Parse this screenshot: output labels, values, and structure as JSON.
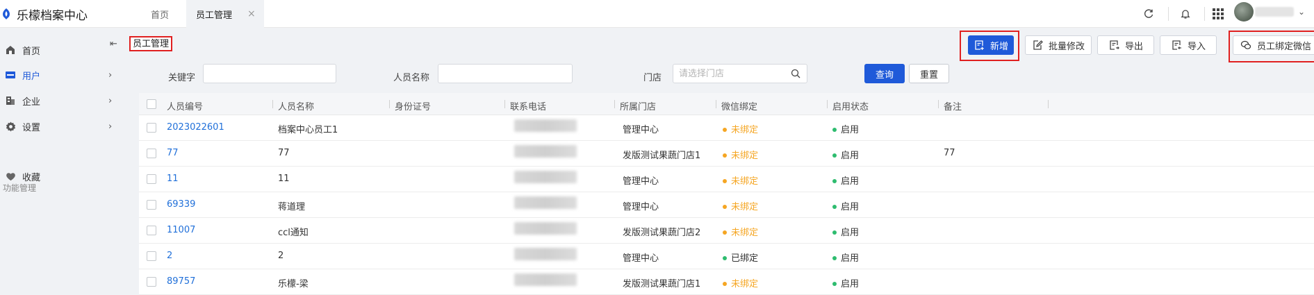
{
  "app": {
    "title": "乐檬档案中心"
  },
  "tabs": [
    {
      "label": "首页"
    },
    {
      "label": "员工管理",
      "close": "×"
    }
  ],
  "sidebar": {
    "collapse_icon": "⇤",
    "items": [
      {
        "label": "首页",
        "icon": "home-icon"
      },
      {
        "label": "用户",
        "icon": "user-card-icon",
        "chevron": "›"
      },
      {
        "label": "企业",
        "icon": "building-icon",
        "chevron": "›"
      },
      {
        "label": "设置",
        "icon": "gear-icon",
        "chevron": "›"
      }
    ],
    "group_label": "功能管理",
    "favorites": {
      "label": "收藏",
      "icon": "heart-icon"
    }
  },
  "page": {
    "title": "员工管理"
  },
  "toolbar": {
    "add": "新增",
    "batch_edit": "批量修改",
    "export": "导出",
    "import": "导入",
    "bind_wechat": "员工绑定微信"
  },
  "filters": {
    "keyword_label": "关键字",
    "name_label": "人员名称",
    "store_label": "门店",
    "store_placeholder": "请选择门店",
    "query": "查询",
    "reset": "重置"
  },
  "table": {
    "columns": [
      "人员编号",
      "人员名称",
      "身份证号",
      "联系电话",
      "所属门店",
      "微信绑定",
      "启用状态",
      "备注"
    ],
    "rows": [
      {
        "id": "2023022601",
        "name": "档案中心员工1",
        "store": "管理中心",
        "wechat": "未绑定",
        "status": "启用",
        "note": ""
      },
      {
        "id": "77",
        "name": "77",
        "store": "发版测试果蔬门店1",
        "wechat": "未绑定",
        "status": "启用",
        "note": "77"
      },
      {
        "id": "11",
        "name": "11",
        "store": "管理中心",
        "wechat": "未绑定",
        "status": "启用",
        "note": ""
      },
      {
        "id": "69339",
        "name": "蒋道理",
        "store": "管理中心",
        "wechat": "未绑定",
        "status": "启用",
        "note": ""
      },
      {
        "id": "11007",
        "name": "ccl通知",
        "store": "发版测试果蔬门店2",
        "wechat": "未绑定",
        "status": "启用",
        "note": ""
      },
      {
        "id": "2",
        "name": "2",
        "store": "管理中心",
        "wechat": "已绑定",
        "status": "启用",
        "note": ""
      },
      {
        "id": "89757",
        "name": "乐檬-梁",
        "store": "发版测试果蔬门店1",
        "wechat": "未绑定",
        "status": "启用",
        "note": ""
      }
    ]
  },
  "colors": {
    "primary": "#1f5ad9",
    "link": "#1f6fd9",
    "unbound": "#f5a623",
    "bound": "#2ebc6f",
    "enabled": "#2ebc6f",
    "highlight": "#e02020"
  }
}
